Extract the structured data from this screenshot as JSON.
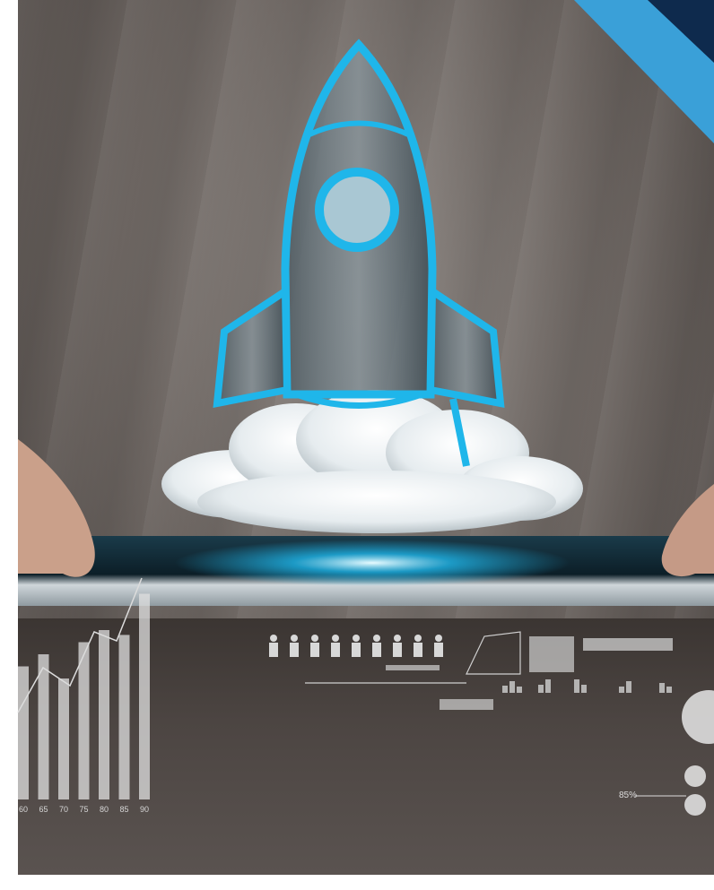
{
  "scene": {
    "description_label": "rocket-launch-over-tablet",
    "accent_color": "#1fb6ea",
    "corner_colors": [
      "#1a4a7a",
      "#3aa0d8"
    ]
  },
  "chart_data": {
    "type": "bar",
    "categories": [
      "60",
      "65",
      "70",
      "75",
      "80",
      "85",
      "90"
    ],
    "values": [
      55,
      60,
      50,
      65,
      70,
      68,
      85
    ],
    "percent_label": "85%"
  }
}
